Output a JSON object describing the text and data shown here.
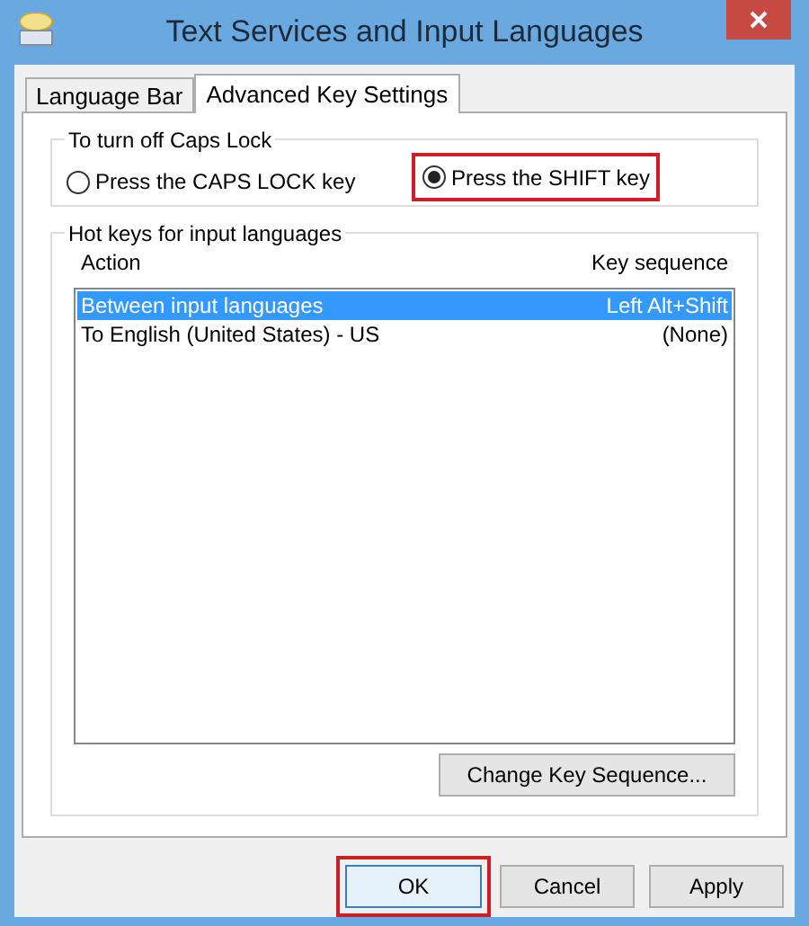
{
  "window": {
    "title": "Text Services and Input Languages"
  },
  "tabs": [
    {
      "label": "Language Bar",
      "selected": false
    },
    {
      "label": "Advanced Key Settings",
      "selected": true
    }
  ],
  "caps_lock": {
    "title": "To turn off Caps Lock",
    "options": [
      {
        "label": "Press the CAPS LOCK key",
        "selected": false,
        "highlighted": false
      },
      {
        "label": "Press the SHIFT key",
        "selected": true,
        "highlighted": true
      }
    ]
  },
  "hot_keys": {
    "title": "Hot keys for input languages",
    "columns": [
      "Action",
      "Key sequence"
    ],
    "rows": [
      {
        "action": "Between input languages",
        "key_sequence": "Left Alt+Shift",
        "selected": true
      },
      {
        "action": "To English (United States) - US",
        "key_sequence": "(None)",
        "selected": false
      }
    ],
    "change_button": "Change Key Sequence..."
  },
  "buttons": [
    {
      "label": "OK",
      "highlighted": true,
      "default": true
    },
    {
      "label": "Cancel",
      "highlighted": false,
      "default": false
    },
    {
      "label": "Apply",
      "highlighted": false,
      "default": false
    }
  ]
}
